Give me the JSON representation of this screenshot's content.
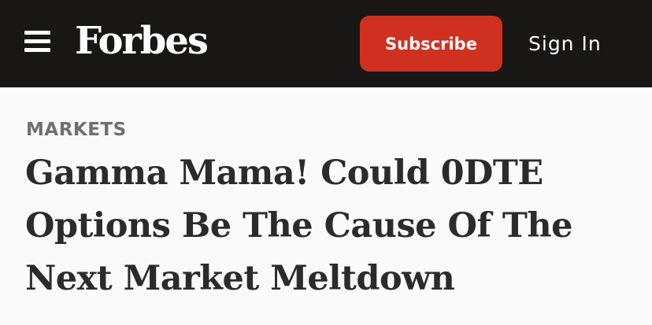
{
  "header": {
    "menu_icon": "hamburger-menu-icon",
    "logo_text": "Forbes",
    "subscribe_label": "Subscribe",
    "signin_label": "Sign In",
    "colors": {
      "bar": "#181716",
      "subscribe": "#d0301f"
    }
  },
  "article": {
    "section": "MARKETS",
    "headline": "Gamma Mama! Could 0DTE Options Be The Cause Of The Next Market Meltdown"
  }
}
